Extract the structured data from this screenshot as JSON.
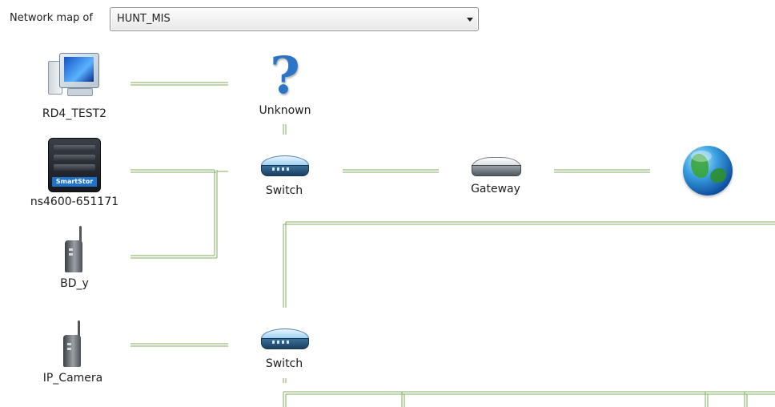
{
  "toolbar": {
    "label": "Network map of",
    "selected_network": "HUNT_MIS"
  },
  "nodes": {
    "rd4": {
      "label": "RD4_TEST2",
      "icon": "computer-icon"
    },
    "unknown": {
      "label": "Unknown",
      "icon": "question-mark-icon"
    },
    "ns4600": {
      "label": "ns4600-651171",
      "icon": "nas-storage-icon",
      "brand": "SmartStor"
    },
    "switch1": {
      "label": "Switch",
      "icon": "switch-icon"
    },
    "gateway": {
      "label": "Gateway",
      "icon": "router-icon"
    },
    "internet": {
      "label": "",
      "icon": "globe-icon"
    },
    "bdy": {
      "label": "BD_y",
      "icon": "wireless-device-icon"
    },
    "ipcamera": {
      "label": "IP_Camera",
      "icon": "wireless-device-icon"
    },
    "switch2": {
      "label": "Switch",
      "icon": "switch-icon"
    }
  },
  "colors": {
    "link_line": "#7fae5e",
    "link_line_light": "#c9dfb8"
  }
}
